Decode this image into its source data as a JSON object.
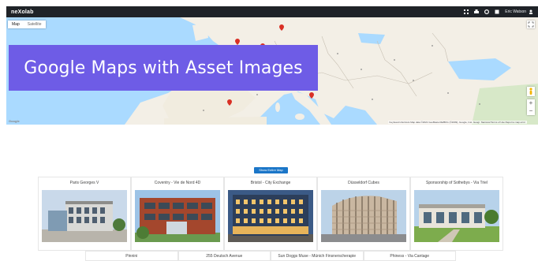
{
  "app": {
    "brand": "neXolab",
    "user_name": "Eric Watson"
  },
  "top_actions": [
    {
      "icon": "apps-icon"
    },
    {
      "icon": "printer-icon"
    },
    {
      "icon": "settings-icon"
    },
    {
      "icon": "notifications-icon"
    }
  ],
  "map": {
    "tabs": [
      {
        "label": "Map"
      },
      {
        "label": "Satellite"
      }
    ],
    "attribution": "Keyboard shortcuts  Map data ©2021 GeoBasis-DE/BKG (©2009), Google, Inst. Geogr. Nacional  Terms of Use  Report a map error",
    "google_logo": "Google",
    "zoom_in": "+",
    "zoom_out": "−",
    "pin_color": "#d93025",
    "water_color": "#aadaff",
    "land_color": "#f3efe6"
  },
  "banner": {
    "title": "Google Maps with Asset Images",
    "color": "#6e5ce6"
  },
  "center_button": {
    "label": "Show Entire Map"
  },
  "cards": [
    {
      "title": "Paris Georges V"
    },
    {
      "title": "Coventry - Vie de Nord 4D"
    },
    {
      "title": "Bristol - City Exchange"
    },
    {
      "title": "Düsseldorf Cubes"
    },
    {
      "title": "Sponsorship of Sothebys - Via Triel"
    }
  ],
  "cards_row2": [
    {
      "title": "Pinnini"
    },
    {
      "title": "255 Deutsch Avenue"
    },
    {
      "title": "Sun Doggs Muse - Münich Finsnerscherapie"
    },
    {
      "title": "Phiness - Via Cantage"
    }
  ]
}
